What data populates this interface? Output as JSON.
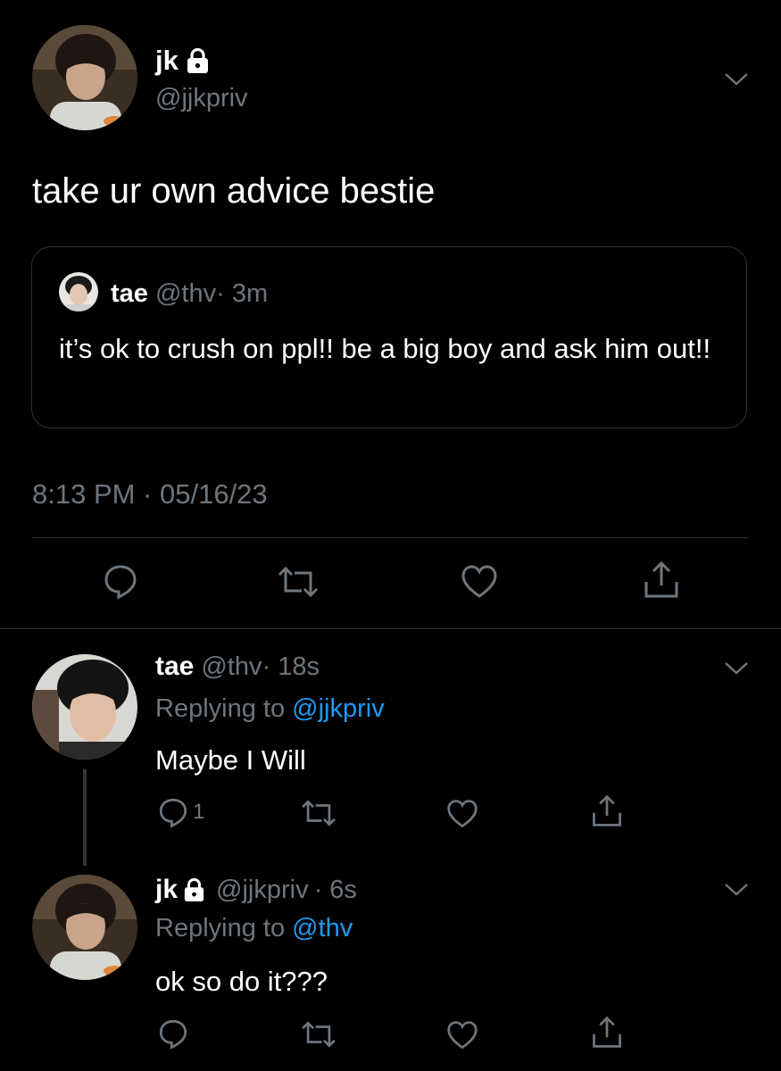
{
  "colors": {
    "background": "#000000",
    "text": "#ffffff",
    "secondary": "#6e767d",
    "link": "#1d9bf0",
    "border": "#2f3336"
  },
  "main_tweet": {
    "display_name": "jk",
    "handle": "@jjkpriv",
    "protected": true,
    "text": "take ur own advice bestie",
    "timestamp": "8:13 PM · 05/16/23",
    "quoted": {
      "display_name": "tae",
      "handle": "@thv",
      "time": "· 3m",
      "text": "it’s ok to crush on ppl!! be a big boy and ask him out!!"
    },
    "actions": [
      "reply-icon",
      "retweet-icon",
      "like-icon",
      "share-icon"
    ]
  },
  "replies": [
    {
      "display_name": "tae",
      "handle": "@thv",
      "time": "· 18s",
      "replying_prefix": "Replying to ",
      "replying_to": "@jjkpriv",
      "text": "Maybe I Will",
      "reply_count": "1"
    },
    {
      "display_name": "jk",
      "handle": "@jjkpriv",
      "time": "· 6s",
      "protected": true,
      "replying_prefix": "Replying to ",
      "replying_to": "@thv",
      "text": "ok so do it???"
    }
  ]
}
